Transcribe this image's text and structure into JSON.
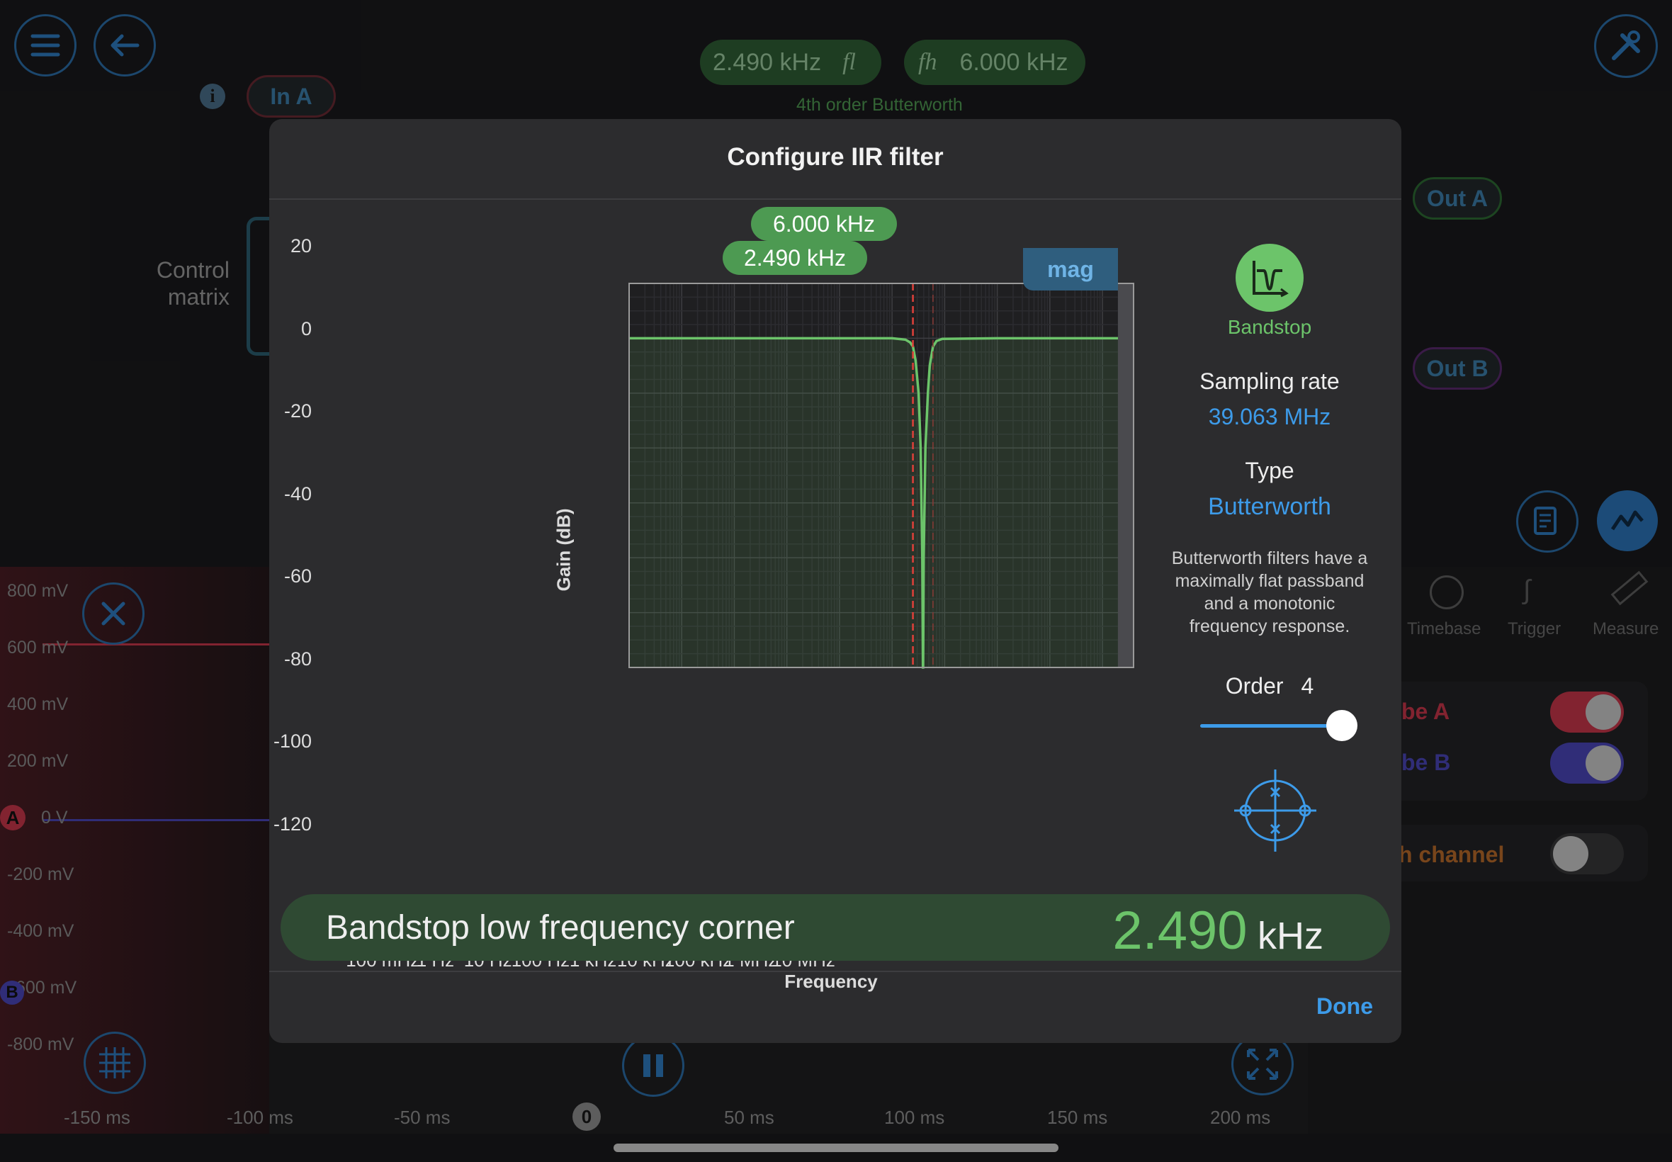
{
  "topbar": {
    "f_low_value": "2.490 kHz",
    "f_low_symbol": "fl",
    "f_high_symbol": "fh",
    "f_high_value": "6.000 kHz",
    "filter_caption": "4th order Butterworth"
  },
  "ports": {
    "in_a": "In A",
    "out_a": "Out A",
    "out_b": "Out B"
  },
  "control_matrix_label": [
    "Control",
    "matrix"
  ],
  "scope": {
    "y_labels": [
      "800 mV",
      "600 mV",
      "400 mV",
      "200 mV",
      "0 V",
      "-200 mV",
      "-400 mV",
      "600 mV",
      "-800 mV"
    ],
    "channel_markers": [
      "A",
      "B"
    ],
    "time_labels": [
      "-150 ms",
      "-100 ms",
      "-50 ms",
      "50 ms",
      "100 ms",
      "150 ms",
      "200 ms"
    ],
    "trigger_marker": "0"
  },
  "right_panel": {
    "tabs": [
      "Timebase",
      "Trigger",
      "Measure"
    ],
    "probe_a_label": "be A",
    "probe_b_label": "be B",
    "math_channel_label": "h channel",
    "probe_a_on": true,
    "probe_b_on": true,
    "math_channel_on": false
  },
  "dialog": {
    "title": "Configure IIR filter",
    "freq_tag_high": "6.000 kHz",
    "freq_tag_low": "2.490 kHz",
    "mag_label": "mag",
    "filter_shape_label": "Bandstop",
    "sampling_rate_label": "Sampling rate",
    "sampling_rate_value": "39.063 MHz",
    "type_label": "Type",
    "type_value": "Butterworth",
    "type_description": [
      "Butterworth filters have a",
      "maximally flat passband",
      "and a monotonic",
      "frequency response."
    ],
    "order_label": "Order",
    "order_value": "4",
    "order_fraction": 1.0,
    "corner_label": "Bandstop low frequency corner",
    "corner_value": "2.490",
    "corner_unit": "kHz",
    "done_label": "Done"
  },
  "chart_data": {
    "type": "line",
    "xlabel": "Frequency",
    "ylabel": "Gain (dB)",
    "x_scale": "log",
    "xlim": [
      0.01,
      39063000
    ],
    "ylim": [
      -120,
      20
    ],
    "y_ticks": [
      "20",
      "0",
      "-20",
      "-40",
      "-60",
      "-80",
      "-100",
      "-120"
    ],
    "x_ticks": [
      {
        "label": "100 mHz",
        "value": 0.1
      },
      {
        "label": "1 Hz",
        "value": 1
      },
      {
        "label": "10 Hz",
        "value": 10
      },
      {
        "label": "100 Hz",
        "value": 100
      },
      {
        "label": "1 kHz",
        "value": 1000
      },
      {
        "label": "10 kHz",
        "value": 10000
      },
      {
        "label": "100 kHz",
        "value": 100000
      },
      {
        "label": "1 MHz",
        "value": 1000000
      },
      {
        "label": "10 MHz",
        "value": 10000000
      }
    ],
    "markers": {
      "f_low": 2490,
      "f_high": 6000
    },
    "series": [
      {
        "x": [
          0.01,
          1000,
          1800,
          2200,
          2490,
          2800,
          3200,
          3500,
          3750,
          3865,
          3900,
          4000,
          4300,
          4800,
          5200,
          6000,
          7000,
          9000,
          100000,
          20000000
        ],
        "values": [
          0,
          0,
          -0.5,
          -1.5,
          -3,
          -8,
          -20,
          -40,
          -80,
          -120,
          -120,
          -80,
          -40,
          -20,
          -10,
          -3,
          -1,
          -0.2,
          0,
          0
        ]
      }
    ],
    "grid": true
  },
  "colors": {
    "accent_blue": "#3d9be9",
    "filter_green": "#6cc46a",
    "marker_red": "#e0403a",
    "probe_a": "#c8374a",
    "probe_b": "#4a45b8"
  },
  "icons": {
    "menu": "menu-icon",
    "back": "back-arrow-icon",
    "tools": "tools-icon",
    "info": "info-icon",
    "close": "close-icon",
    "notes": "notes-icon",
    "trace": "trace-icon",
    "grid": "grid-icon",
    "pause": "pause-icon",
    "fullscreen": "fullscreen-icon",
    "bandstop": "bandstop-icon",
    "pole_zero": "pole-zero-icon"
  }
}
